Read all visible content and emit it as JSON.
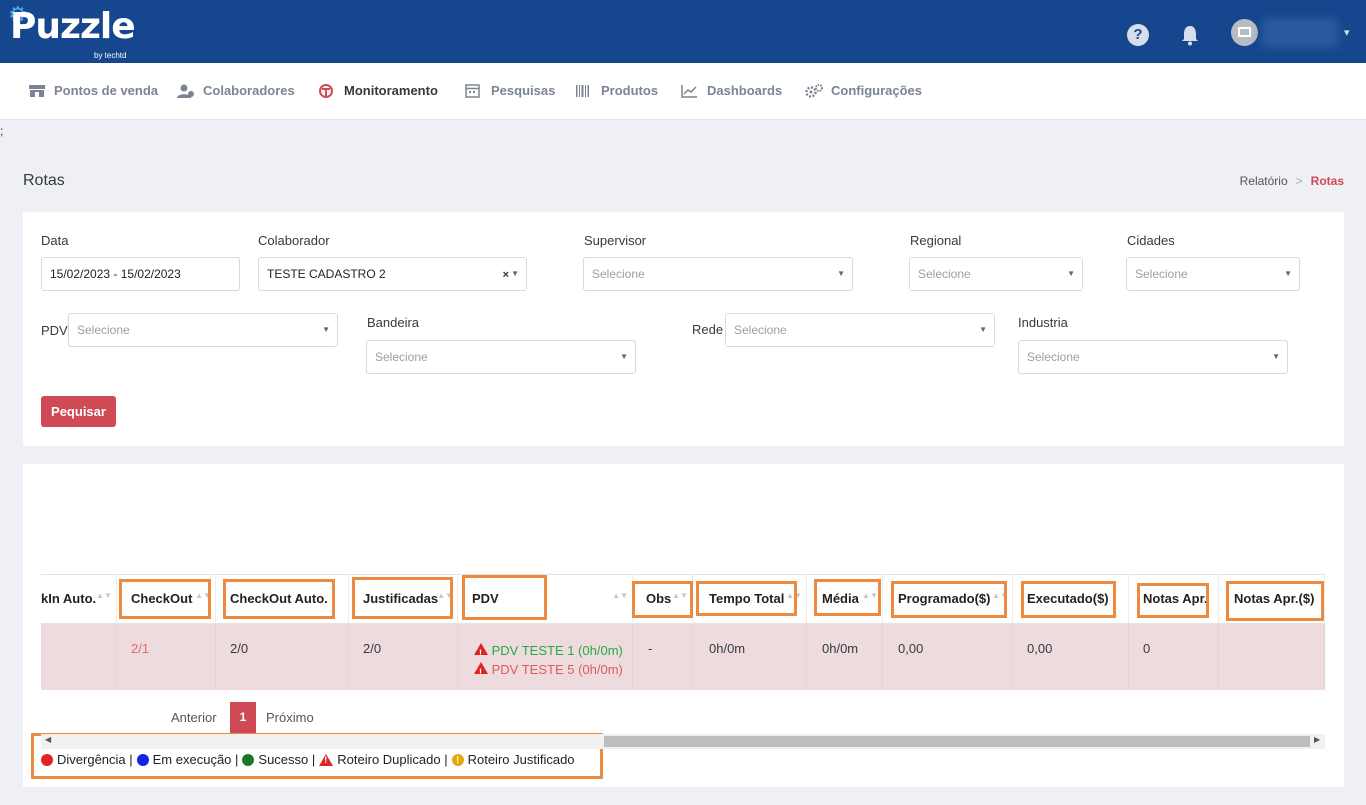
{
  "header": {
    "logo": "Puzzle",
    "logo_sub": "by techtd",
    "help_glyph": "?",
    "caret_glyph": "▾"
  },
  "nav": [
    {
      "label": "Pontos de venda",
      "icon": "store-icon"
    },
    {
      "label": "Colaboradores",
      "icon": "users-icon"
    },
    {
      "label": "Monitoramento",
      "icon": "monitor-icon",
      "active": true
    },
    {
      "label": "Pesquisas",
      "icon": "calendar-icon"
    },
    {
      "label": "Produtos",
      "icon": "barcode-icon"
    },
    {
      "label": "Dashboards",
      "icon": "chart-icon"
    },
    {
      "label": "Configurações",
      "icon": "gears-icon"
    }
  ],
  "stray_text": ";",
  "page": {
    "title": "Rotas",
    "breadcrumb": [
      "Relatório",
      ">",
      "Rotas"
    ]
  },
  "filters": {
    "data_label": "Data",
    "data_value": "15/02/2023 - 15/02/2023",
    "colaborador_label": "Colaborador",
    "colaborador_value": "TESTE CADASTRO 2",
    "clear_glyph": "×",
    "supervisor_label": "Supervisor",
    "regional_label": "Regional",
    "cidades_label": "Cidades",
    "pdv_label": "PDV",
    "bandeira_label": "Bandeira",
    "rede_label": "Rede",
    "industria_label": "Industria",
    "placeholder": "Selecione",
    "caret_glyph": "▼",
    "search_button": "Pequisar"
  },
  "table": {
    "headers": [
      "kIn Auto.",
      "CheckOut",
      "CheckOut Auto.",
      "Justificadas",
      "PDV",
      "Obs",
      "Tempo Total",
      "Média",
      "Programado($)",
      "Executado($)",
      "Notas Apr.",
      "Notas Apr.($)"
    ],
    "row": {
      "checkin_auto": "",
      "checkout": "2/1",
      "checkout_auto": "2/0",
      "justificadas": "2/0",
      "pdv": [
        "PDV TESTE 1 (0h/0m)",
        "PDV TESTE 5 (0h/0m)"
      ],
      "obs": "-",
      "tempo_total": "0h/0m",
      "media": "0h/0m",
      "programado": "0,00",
      "executado": "0,00",
      "notas_apr": "0",
      "notas_apr_valor": ""
    },
    "sort_glyph": "▲▼"
  },
  "pagination": {
    "prev": "Anterior",
    "current": "1",
    "next": "Próximo"
  },
  "scroll": {
    "left_glyph": "◀",
    "right_glyph": "▶"
  },
  "legend": {
    "divergencia": "Divergência |",
    "em_execucao": "Em execução |",
    "sucesso": "Sucesso |",
    "duplicado": "Roteiro Duplicado |",
    "justificado": "Roteiro Justificado",
    "justificado_glyph": "!"
  },
  "colors": {
    "brand_blue": "#16468d",
    "accent_red": "#d04a55",
    "highlight_orange": "#ec8a3f",
    "row_bg": "#eddbdd",
    "success_green": "#2aa84a",
    "status_red": "#e02424",
    "status_blue": "#1025e6",
    "status_green": "#1a7a23",
    "status_yellow": "#e5a60f"
  }
}
